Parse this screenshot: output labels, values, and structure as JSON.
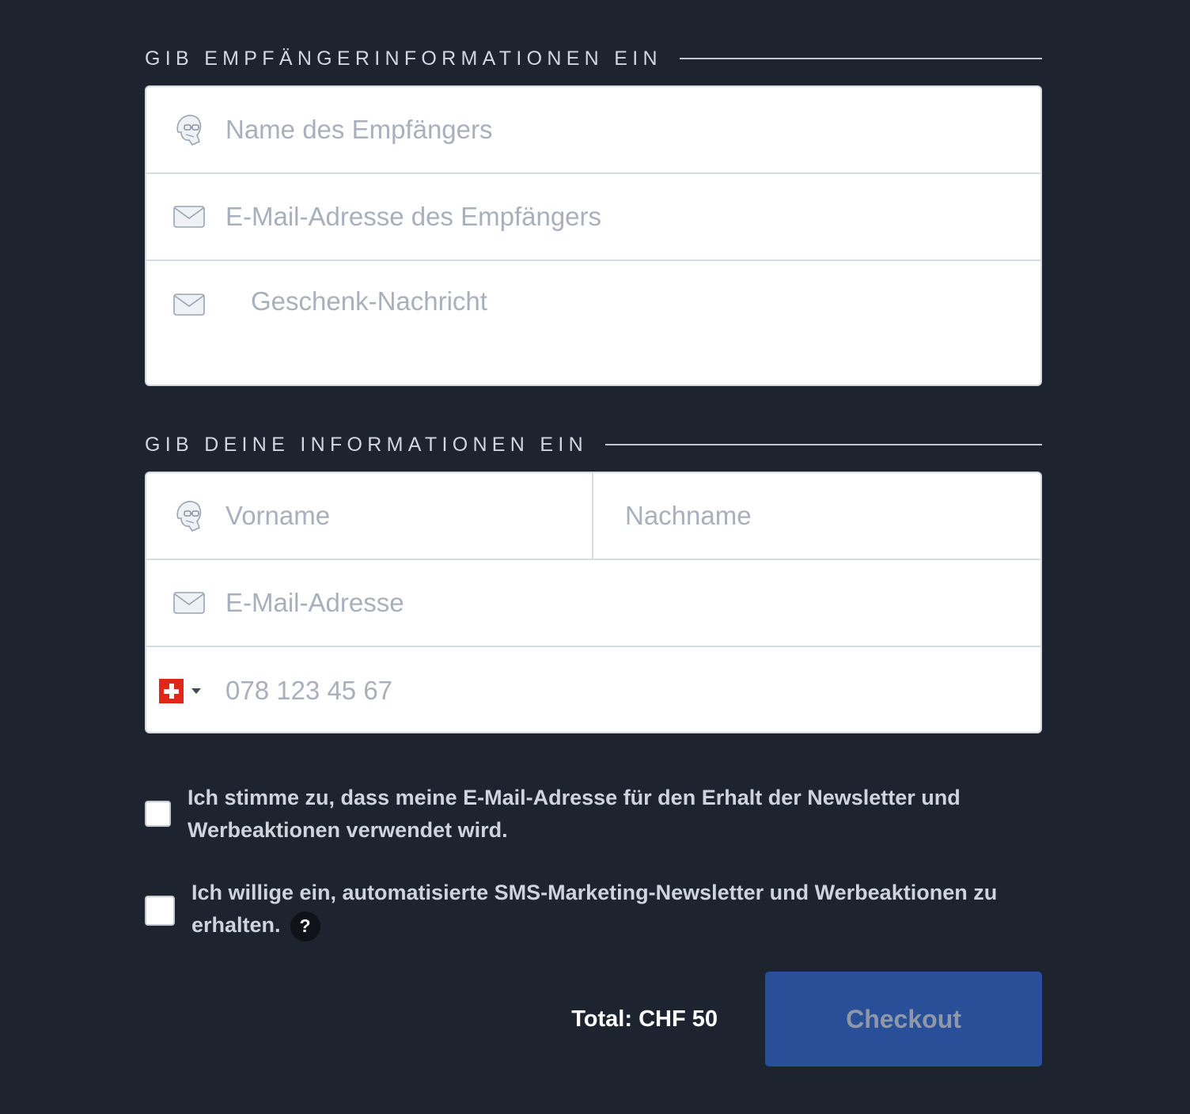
{
  "recipient": {
    "heading": "GIB EMPFÄNGERINFORMATIONEN EIN",
    "name_placeholder": "Name des Empfängers",
    "email_placeholder": "E-Mail-Adresse des Empfängers",
    "message_placeholder": "Geschenk-Nachricht"
  },
  "sender": {
    "heading": "GIB DEINE INFORMATIONEN EIN",
    "first_name_placeholder": "Vorname",
    "last_name_placeholder": "Nachname",
    "email_placeholder": "E-Mail-Adresse",
    "phone_placeholder": "078 123 45 67",
    "phone_country_icon": "swiss-flag"
  },
  "consents": {
    "newsletter": "Ich stimme zu, dass meine E-Mail-Adresse für den Erhalt der Newsletter und Werbeaktionen verwendet wird.",
    "sms": "Ich willige ein, automatisierte SMS-Marketing-Newsletter und Werbeaktionen zu erhalten.",
    "help_symbol": "?"
  },
  "footer": {
    "total": "Total: CHF 50",
    "checkout_label": "Checkout"
  },
  "colors": {
    "background": "#1e2330",
    "checkout_button": "#284f97",
    "flag_red": "#e0271a"
  }
}
